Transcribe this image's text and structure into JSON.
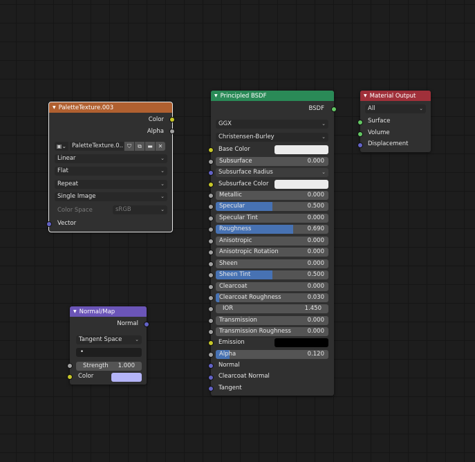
{
  "palette": {
    "title": "PaletteTexture.003",
    "out_color": "Color",
    "out_alpha": "Alpha",
    "image_name": "PaletteTexture.0..",
    "icons": [
      "image-icon",
      "shield-icon",
      "copy-icon",
      "folder-icon",
      "close-icon"
    ],
    "interpolation": "Linear",
    "projection": "Flat",
    "extension": "Repeat",
    "source": "Single Image",
    "color_space_label": "Color Space",
    "color_space_value": "sRGB",
    "in_vector": "Vector"
  },
  "normal_map": {
    "title": "Normal/Map",
    "out_normal": "Normal",
    "space": "Tangent Space",
    "uv_map": "•",
    "strength_label": "Strength",
    "strength_value": "1.000",
    "color_label": "Color",
    "color_swatch": "#b4b4f7"
  },
  "bsdf": {
    "title": "Principled BSDF",
    "out_bsdf": "BSDF",
    "distribution": "GGX",
    "subsurface_method": "Christensen-Burley",
    "base_color_label": "Base Color",
    "base_color_swatch": "#ececec",
    "subsurface_label": "Subsurface",
    "subsurface_value": "0.000",
    "subsurface_radius_label": "Subsurface Radius",
    "subsurface_color_label": "Subsurface Color",
    "subsurface_color_swatch": "#ececec",
    "metallic_label": "Metallic",
    "metallic_value": "0.000",
    "specular_label": "Specular",
    "specular_value": "0.500",
    "specular_tint_label": "Specular Tint",
    "specular_tint_value": "0.000",
    "roughness_label": "Roughness",
    "roughness_value": "0.690",
    "anisotropic_label": "Anisotropic",
    "anisotropic_value": "0.000",
    "anisotropic_rotation_label": "Anisotropic Rotation",
    "anisotropic_rotation_value": "0.000",
    "sheen_label": "Sheen",
    "sheen_value": "0.000",
    "sheen_tint_label": "Sheen Tint",
    "sheen_tint_value": "0.500",
    "clearcoat_label": "Clearcoat",
    "clearcoat_value": "0.000",
    "clearcoat_roughness_label": "Clearcoat Roughness",
    "clearcoat_roughness_value": "0.030",
    "ior_label": "IOR",
    "ior_value": "1.450",
    "transmission_label": "Transmission",
    "transmission_value": "0.000",
    "transmission_roughness_label": "Transmission Roughness",
    "transmission_roughness_value": "0.000",
    "emission_label": "Emission",
    "emission_swatch": "#000000",
    "alpha_label": "Alpha",
    "alpha_value": "0.120",
    "normal_label": "Normal",
    "clearcoat_normal_label": "Clearcoat Normal",
    "tangent_label": "Tangent"
  },
  "output": {
    "title": "Material Output",
    "target": "All",
    "surface": "Surface",
    "volume": "Volume",
    "displacement": "Displacement"
  },
  "colors": {
    "palette_header": "#b06030",
    "normal_header": "#6b55b8",
    "bsdf_header": "#2a8a57",
    "output_header": "#a0303a",
    "slider_fill": "#4772b3"
  }
}
